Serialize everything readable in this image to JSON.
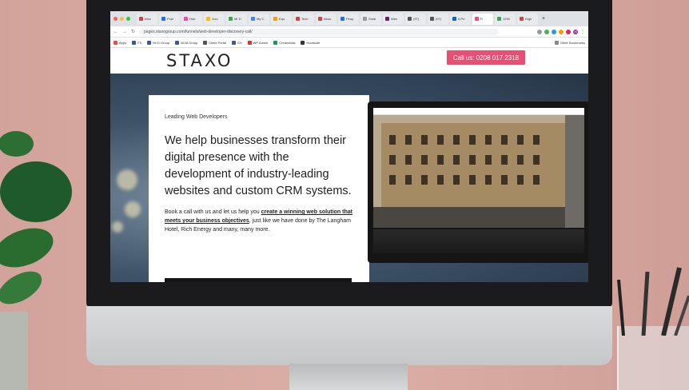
{
  "browser": {
    "tabs": [
      "Inbo",
      "Post",
      "Hub",
      "Goo",
      "Mr D",
      "My C",
      "Equ",
      "Tech",
      "Abou",
      "Peop",
      "Smal",
      "Wee",
      "(97)",
      "(97)",
      "A Pe",
      "R",
      "1200",
      "Digit"
    ],
    "new_tab_label": "+",
    "url": "pages.staxogroup.com/funnels/web-developer-discovery-call/",
    "bookmarks": [
      "Apps",
      "FS",
      "Mr D Group",
      "MLM Group",
      "Client Portal",
      "CS",
      "WP Admin",
      "Credentials",
      "Hootsuite"
    ],
    "other_bookmarks": "Other Bookmarks",
    "profile_initial": "M"
  },
  "site": {
    "logo": "STAXO",
    "cta": "Call us: 0208 017 2318",
    "eyebrow": "Leading Web Developers",
    "headline": "We help businesses transform their digital presence with the development of industry-leading websites and custom CRM systems.",
    "body_prefix": "Book a call with us and let us help you ",
    "body_link": "create a winning web solution that meets your business objectives",
    "body_suffix": ", just like we have done by The Langham Hotel, Rich Energy and many, many more."
  }
}
